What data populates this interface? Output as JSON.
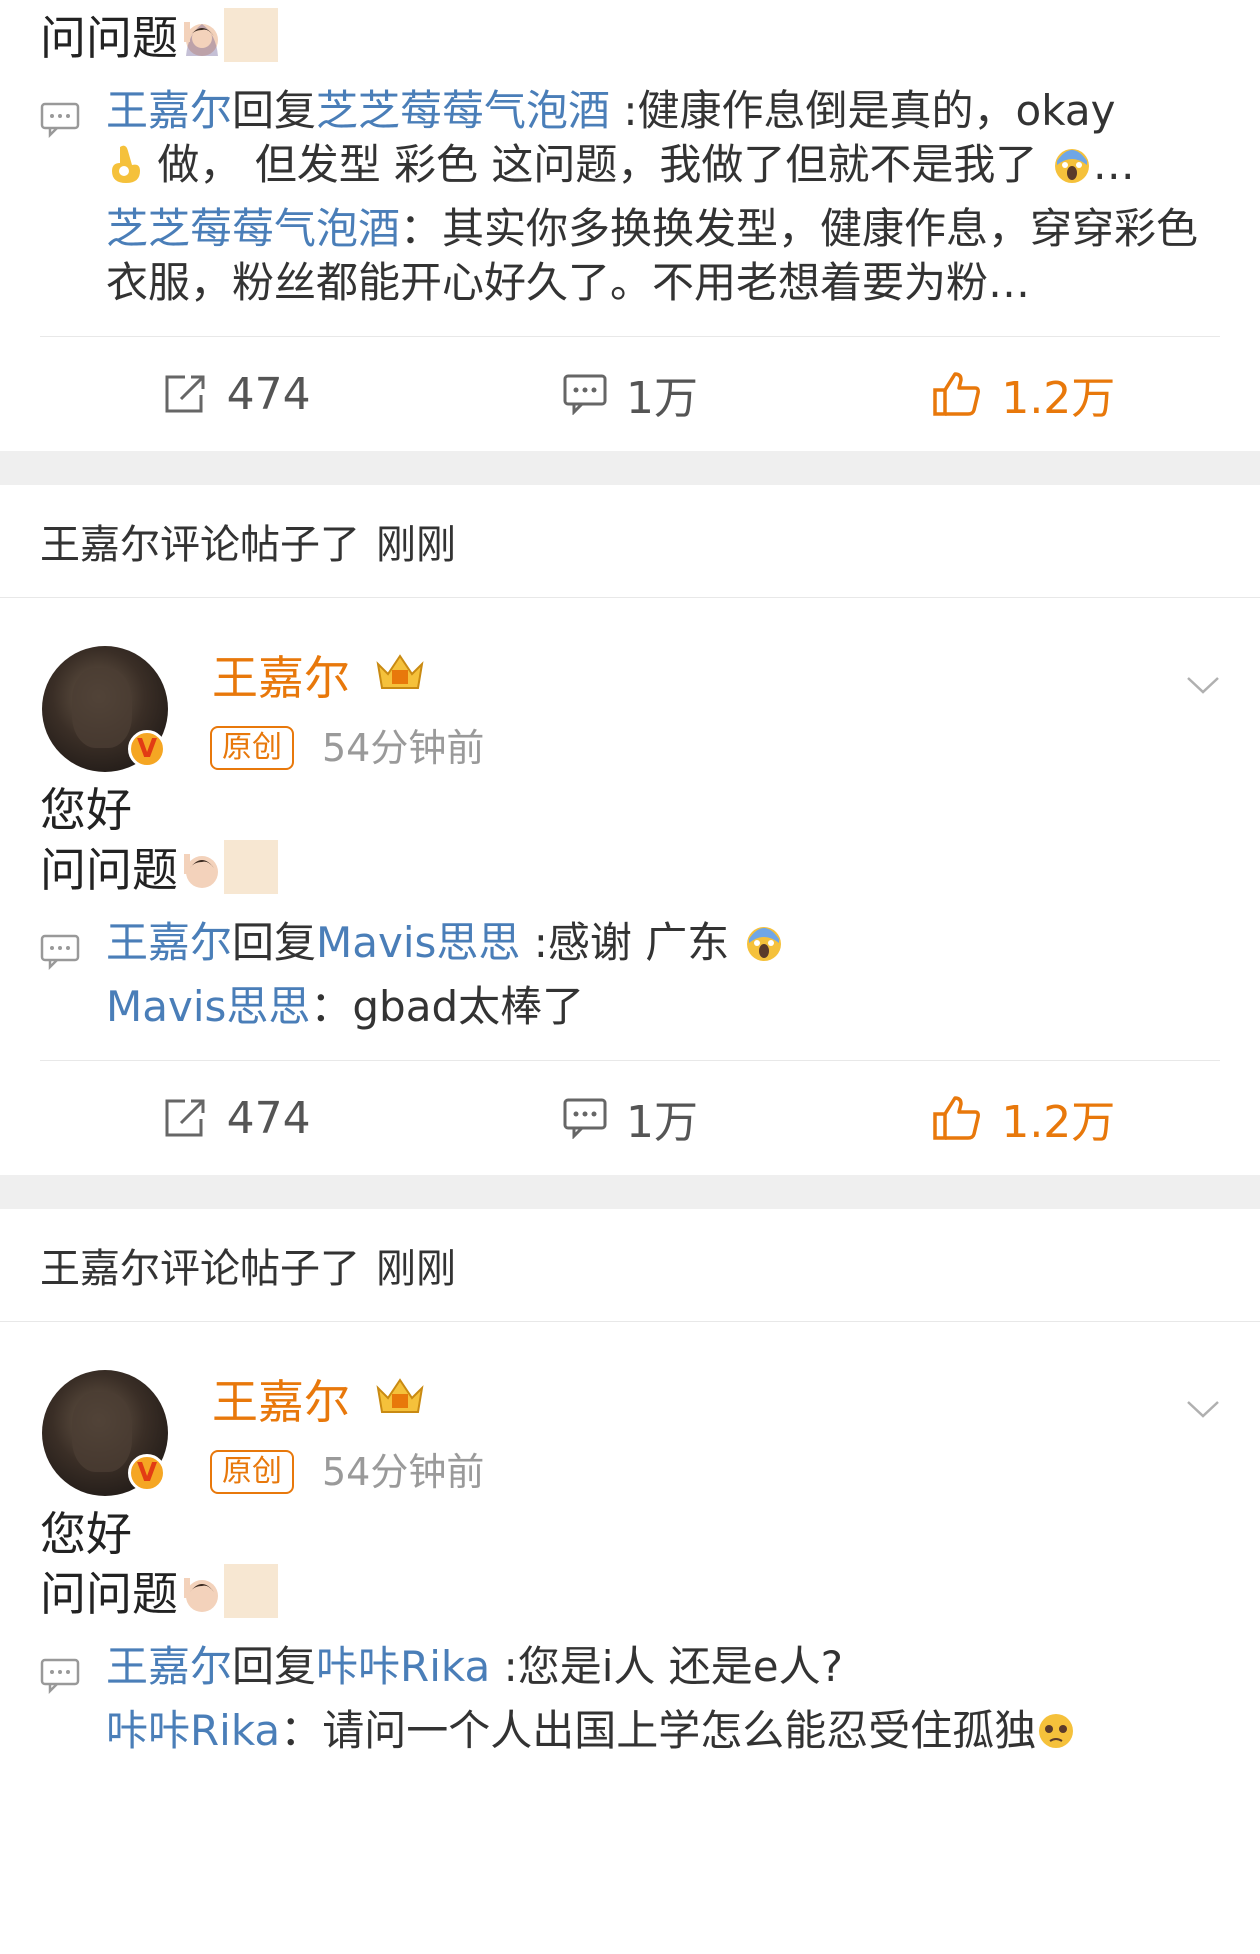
{
  "top_post": {
    "content_line": "问问题",
    "reply": {
      "author": "王嘉尔",
      "reply_word": "回复",
      "target": "芝芝莓莓气泡酒",
      "text_a": " :健康作息倒是真的，okay",
      "text_b": " 做，  但发型 彩色 这问题，我做了但就不是我了",
      "ellipsis": "…",
      "quote_author": "芝芝莓莓气泡酒",
      "quote_text": "：其实你多换换发型，健康作息，穿穿彩色衣服，粉丝都能开心好久了。不用老想着要为粉…"
    },
    "actions": {
      "repost": "474",
      "comments": "1万",
      "likes": "1.2万"
    }
  },
  "posts": [
    {
      "header": {
        "title": "王嘉尔评论帖子了",
        "time": "刚刚"
      },
      "author": {
        "name": "王嘉尔",
        "tag": "原创",
        "time_ago": "54分钟前",
        "verified_mark": "V"
      },
      "content": {
        "line1": "您好",
        "line2": "问问题"
      },
      "reply": {
        "author": "王嘉尔",
        "reply_word": "回复",
        "target": "Mavis思思",
        "text": " :感谢 广东 ",
        "quote_author": "Mavis思思",
        "quote_text": "：gbad太棒了"
      },
      "actions": {
        "repost": "474",
        "comments": "1万",
        "likes": "1.2万"
      }
    },
    {
      "header": {
        "title": "王嘉尔评论帖子了",
        "time": "刚刚"
      },
      "author": {
        "name": "王嘉尔",
        "tag": "原创",
        "time_ago": "54分钟前",
        "verified_mark": "V"
      },
      "content": {
        "line1": "您好",
        "line2": "问问题"
      },
      "reply": {
        "author": "王嘉尔",
        "reply_word": "回复",
        "target": "咔咔Rika",
        "text": " :您是i人 还是e人?",
        "quote_author": "咔咔Rika",
        "quote_text": "：请问一个人出国上学怎么能忍受住孤独"
      }
    }
  ],
  "colors": {
    "link_blue": "#4a7eb8",
    "orange": "#e8780b",
    "divider": "#efefef"
  },
  "icons": [
    "repost-icon",
    "comment-icon",
    "like-icon",
    "comment-bubble-icon",
    "crown-icon",
    "chevron-down-icon",
    "verified-icon"
  ]
}
